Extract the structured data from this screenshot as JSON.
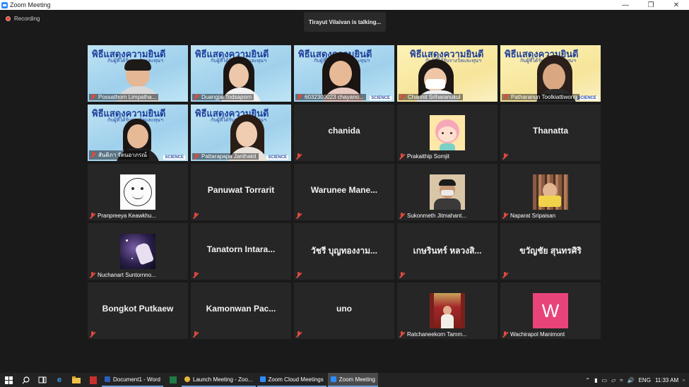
{
  "window": {
    "title": "Zoom Meeting"
  },
  "recording_label": "Recording",
  "talking": "Tirayut Vilaivan is talking...",
  "banner": {
    "text": "พิธีแสดงความยินดี",
    "sub": "กับผู้ที่ได้รับรางวัลและทุนฯ",
    "badge": "SCIENCE"
  },
  "tiles": [
    {
      "name": "Possathorn Limpatha...",
      "type": "video"
    },
    {
      "name": "Duangjai Todsaporn",
      "type": "video"
    },
    {
      "name": "6032309023 chayano...",
      "type": "video"
    },
    {
      "name": "Channit Sriharanukul",
      "type": "video"
    },
    {
      "name": "Patharanun Toolkiattiwong",
      "type": "video"
    },
    {
      "name": "สันติภา รัตนอาภรณ์",
      "type": "video"
    },
    {
      "name": "Pattarapapa Janthakit",
      "type": "video"
    },
    {
      "name": "",
      "big": "chanida",
      "type": "name"
    },
    {
      "name": "Prakaithip Somjit",
      "type": "avatar"
    },
    {
      "name": "",
      "big": "Thanatta",
      "type": "name"
    },
    {
      "name": "Pranpreeya Keawkhu...",
      "type": "avatar"
    },
    {
      "name": "",
      "big": "Panuwat Torrarit",
      "type": "name"
    },
    {
      "name": "",
      "big": "Warunee Mane...",
      "type": "name"
    },
    {
      "name": "Sukonmeth Jitmahant...",
      "type": "avatar"
    },
    {
      "name": "Naparat Sripaisan",
      "type": "avatar"
    },
    {
      "name": "Nuchanart Suntornno...",
      "type": "avatar"
    },
    {
      "name": "",
      "big": "Tanatorn Intara...",
      "type": "name"
    },
    {
      "name": "",
      "big": "วัชรี บุญทองงาม...",
      "type": "name"
    },
    {
      "name": "",
      "big": "เกษรินทร์ หลวงสิ...",
      "type": "name"
    },
    {
      "name": "",
      "big": "ขวัญชัย สุนทรศิริ",
      "type": "name"
    },
    {
      "name": "",
      "big": "Bongkot Putkaew",
      "type": "name"
    },
    {
      "name": "",
      "big": "Kamonwan Pac...",
      "type": "name"
    },
    {
      "name": "",
      "big": "uno",
      "type": "name"
    },
    {
      "name": "Ratchaneekorn Tamm...",
      "type": "avatar"
    },
    {
      "name": "Wachirapol Manimont",
      "type": "avatar",
      "letter": "W"
    }
  ],
  "taskbar": {
    "apps": [
      "Document1 - Word",
      "Launch Meeting - Zoo...",
      "Zoom Cloud Meetings",
      "Zoom Meeting"
    ],
    "lang": "ENG",
    "time": "11:33 AM"
  },
  "colors": {
    "accent": "#2d8cff",
    "mic_muted": "#e04a3f",
    "tile_bg": "#262626"
  }
}
